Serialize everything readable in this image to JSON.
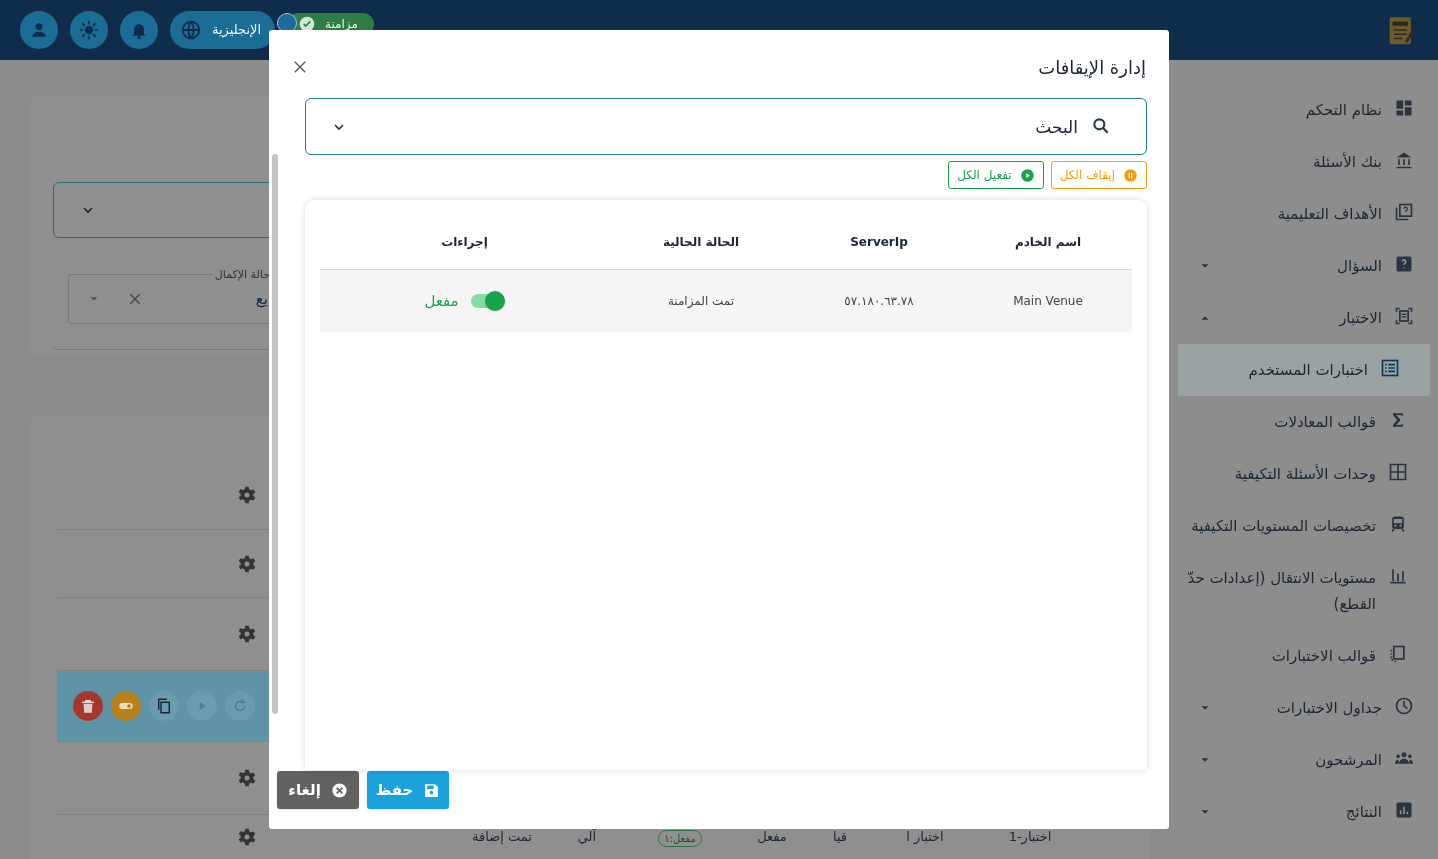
{
  "header": {
    "language": "الإنجليزية",
    "sync": "مزامنة"
  },
  "sidebar": {
    "items": [
      {
        "label": "نظام التحكم",
        "selected": false
      },
      {
        "label": "بنك الأسئلة",
        "selected": false
      },
      {
        "label": "الأهداف التعليمية",
        "selected": false
      },
      {
        "label": "السؤال",
        "selected": false,
        "expanded": false
      },
      {
        "label": "الاختبار",
        "selected": false,
        "expanded": true,
        "children": [
          {
            "label": "اختبارات المستخدم",
            "selected": true
          },
          {
            "label": "قوالب المعادلات",
            "selected": false
          },
          {
            "label": "وحدات الأسئلة التكيفية",
            "selected": false
          },
          {
            "label": "تخصيصات المستويات التكيفية",
            "selected": false
          },
          {
            "label": "مستويات الانتقال (إعدادات حدّ القطع)",
            "selected": false
          },
          {
            "label": "قوالب الاختبارات",
            "selected": false
          }
        ]
      },
      {
        "label": "جداول الاختبارات",
        "selected": false,
        "expanded": false
      },
      {
        "label": "المرشحون",
        "selected": false,
        "expanded": false
      },
      {
        "label": "النتائج",
        "selected": false,
        "expanded": false
      }
    ]
  },
  "background": {
    "filter_label": "حالة الإكمال",
    "filter_value": "يع",
    "last_row": [
      "اختبار-1",
      "اختبار ا",
      "قيا",
      "مفعل",
      "مفعل:١",
      "آلي",
      "تمت إضافة"
    ]
  },
  "dialog": {
    "title": "إدارة الإيقافات",
    "search": {
      "placeholder": "البحث"
    },
    "bulk_buttons": [
      {
        "kind": "pause",
        "label": "إيقاف الكل"
      },
      {
        "kind": "play",
        "label": "تفعيل الكل"
      }
    ],
    "table": {
      "columns": [
        "اسم الخادم",
        "ServerIp",
        "الحالة الحالية",
        "إجراءات"
      ],
      "rows": [
        {
          "server_name": "Main Venue",
          "server_ip": "٥٧.١٨٠.٦٣.٧٨",
          "status": "تمت المزامنة",
          "enabled": true,
          "action_label": "مفعل"
        }
      ]
    },
    "buttons": [
      {
        "kind": "save",
        "label": "حفظ"
      },
      {
        "kind": "cancel",
        "label": "إلغاء"
      }
    ]
  }
}
